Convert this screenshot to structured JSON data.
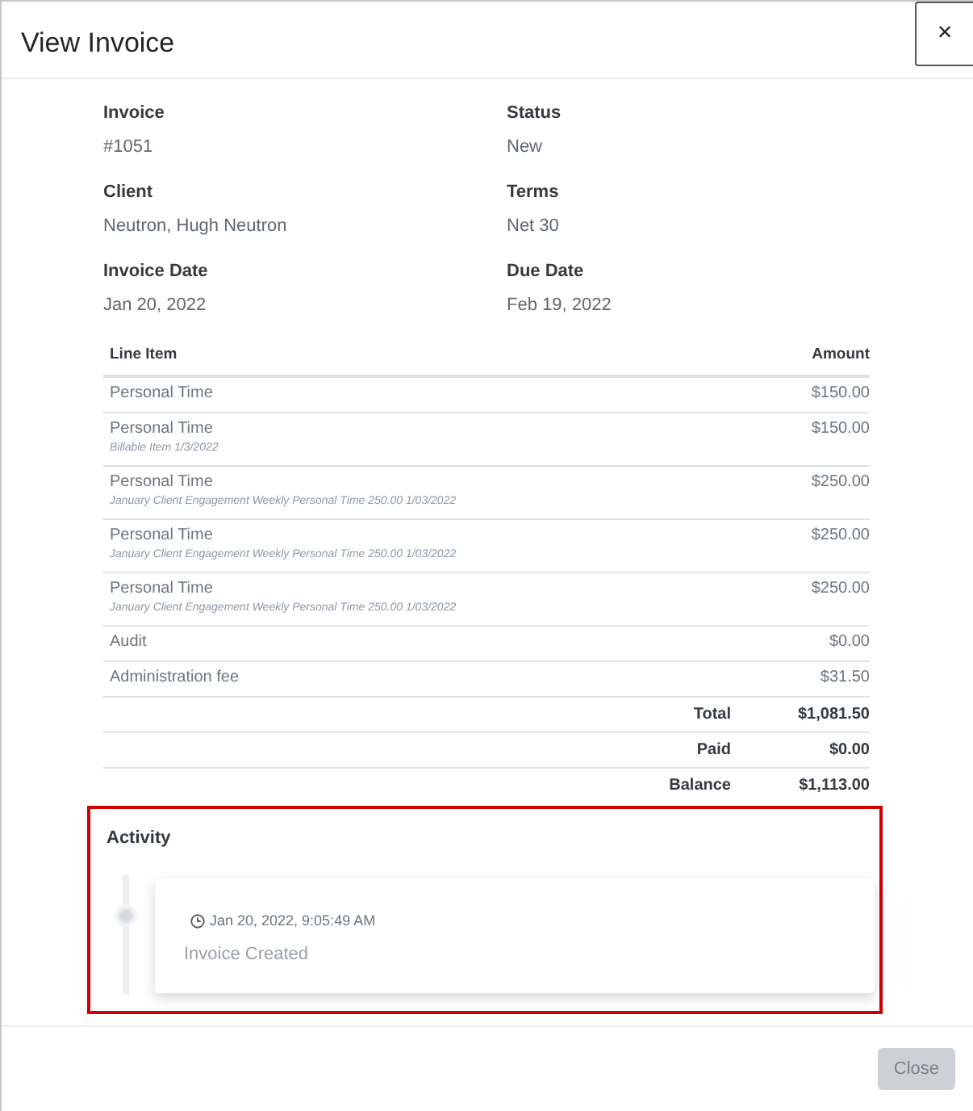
{
  "window": {
    "title": "View Invoice",
    "close_label": "×"
  },
  "details": [
    {
      "label": "Invoice",
      "value": "#1051"
    },
    {
      "label": "Status",
      "value": "New"
    },
    {
      "label": "Client",
      "value": "Neutron, Hugh Neutron"
    },
    {
      "label": "Terms",
      "value": "Net 30"
    },
    {
      "label": "Invoice Date",
      "value": "Jan 20, 2022"
    },
    {
      "label": "Due Date",
      "value": "Feb 19, 2022"
    }
  ],
  "table": {
    "columns": [
      "Line Item",
      "Amount"
    ],
    "rows": [
      {
        "description": "Personal Time",
        "amount": "$150.00"
      },
      {
        "description": "Personal Time",
        "note": "Billable Item 1/3/2022",
        "amount": "$150.00"
      },
      {
        "description": "Personal Time",
        "note": "January Client Engagement Weekly Personal Time 250.00 1/03/2022",
        "amount": "$250.00"
      },
      {
        "description": "Personal Time",
        "note": "January Client Engagement Weekly Personal Time 250.00 1/03/2022",
        "amount": "$250.00"
      },
      {
        "description": "Personal Time",
        "note": "January Client Engagement Weekly Personal Time 250.00 1/03/2022",
        "amount": "$250.00"
      },
      {
        "description": "Audit",
        "amount": "$0.00"
      },
      {
        "description": "Administration fee",
        "amount": "$31.50"
      }
    ],
    "totals": [
      {
        "label": "Total",
        "value": "$1,081.50"
      },
      {
        "label": "Paid",
        "value": "$0.00"
      },
      {
        "label": "Balance",
        "value": "$1,113.00"
      }
    ]
  },
  "activity": {
    "title": "Activity",
    "highlighted": true,
    "events": [
      {
        "time": "Jan 20, 2022, 9:05:49 AM",
        "text": "Invoice Created"
      }
    ]
  },
  "footer": {
    "buttons": [
      "Close"
    ]
  }
}
